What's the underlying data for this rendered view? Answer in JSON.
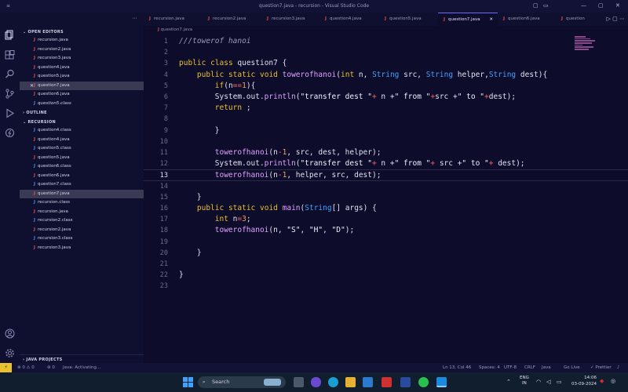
{
  "window": {
    "menu": "≡",
    "title": "question7.java - recursion - Visual Studio Code",
    "controls": [
      "▢",
      "▭",
      "—",
      "▢",
      "✕"
    ]
  },
  "sidebar": {
    "open_editors_label": "OPEN EDITORS",
    "open_editors": [
      {
        "name": "recursion.java",
        "type": "j"
      },
      {
        "name": "recursion2.java",
        "type": "j"
      },
      {
        "name": "recursion3.java",
        "type": "j"
      },
      {
        "name": "question4.java",
        "type": "j"
      },
      {
        "name": "question5.java",
        "type": "j"
      },
      {
        "name": "question7.java",
        "type": "j",
        "selected": true,
        "close": "✕"
      },
      {
        "name": "question6.java",
        "type": "j"
      },
      {
        "name": "question5.class",
        "type": "c"
      }
    ],
    "outline_label": "OUTLINE",
    "recursion_label": "RECURSION",
    "files": [
      {
        "name": "question4.class",
        "type": "c"
      },
      {
        "name": "question4.java",
        "type": "j"
      },
      {
        "name": "question5.class",
        "type": "c"
      },
      {
        "name": "question5.java",
        "type": "j"
      },
      {
        "name": "question6.class",
        "type": "c"
      },
      {
        "name": "question6.java",
        "type": "j"
      },
      {
        "name": "question7.class",
        "type": "c"
      },
      {
        "name": "question7.java",
        "type": "j",
        "selected": true
      },
      {
        "name": "recursion.class",
        "type": "c"
      },
      {
        "name": "recursion.java",
        "type": "j"
      },
      {
        "name": "recursion2.class",
        "type": "c"
      },
      {
        "name": "recursion2.java",
        "type": "j"
      },
      {
        "name": "recursion3.class",
        "type": "c"
      },
      {
        "name": "recursion3.java",
        "type": "j"
      }
    ],
    "java_projects_label": "JAVA PROJECTS"
  },
  "tabs": [
    {
      "label": "recursion.java"
    },
    {
      "label": "recursion2.java"
    },
    {
      "label": "recursion3.java"
    },
    {
      "label": "question4.java"
    },
    {
      "label": "question5.java"
    },
    {
      "label": "question7.java",
      "active": true
    },
    {
      "label": "question6.java"
    },
    {
      "label": "question"
    }
  ],
  "tab_icons": "▷ ▢ ⋯",
  "breadcrumb": "question7.java",
  "status": {
    "errors": "⊗ 0 ⚠ 0",
    "ports": "⊛ 0",
    "java": "Java: Activating...",
    "position": "Ln 13, Col 46",
    "spaces": "Spaces: 4",
    "encoding": "UTF-8",
    "eol": "CRLF",
    "language": "Java",
    "golive": "Go Live",
    "prettier": "✓ Prettier"
  },
  "taskbar": {
    "search": "Search",
    "lang": "ENG",
    "region": "IN",
    "time": "14:06",
    "date": "03-09-2024"
  },
  "code": [
    "///towerof hanoi",
    "",
    "public class question7 {",
    "    public static void towerofhanoi(int n, String src, String helper,String dest){",
    "        if(n==1){",
    "        System.out.println(\"transfer dest \"+ n +\" from \"+src +\" to \"+dest);",
    "        return ;",
    "",
    "        }",
    "",
    "        towerofhanoi(n-1, src, dest, helper);",
    "        System.out.println(\"transfer dest \"+ n +\" from \"+ src +\" to \"+ dest);",
    "        towerofhanoi(n-1, helper, src, dest);",
    "",
    "    }",
    "    public static void main(String[] args) {",
    "        int n=3;",
    "        towerofhanoi(n, \"S\", \"H\", \"D\");",
    "",
    "    }",
    "",
    "}",
    ""
  ],
  "current_line": 13
}
